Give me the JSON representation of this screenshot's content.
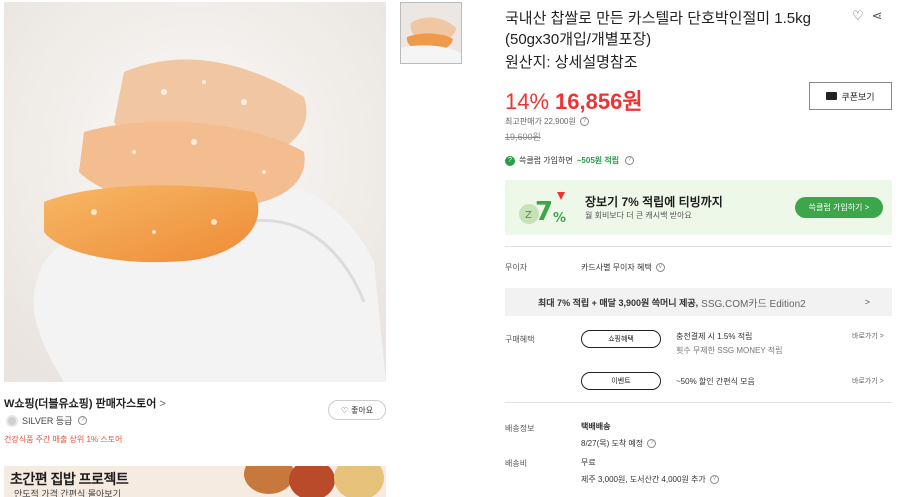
{
  "product": {
    "title": "국내산 찹쌀로 만든 카스텔라 단호박인절미 1.5kg (50gx30개입/개별포장)",
    "origin": "원산지: 상세설명참조",
    "discount": "14%",
    "price": "16,856원",
    "max_benefit": "최고판매가 22,900원",
    "original_price": "19,600원"
  },
  "actions": {
    "coupon_label": "쿠폰보기",
    "like_label": "좋아요",
    "wish_icon": "heart-icon",
    "share_icon": "share-icon"
  },
  "seller": {
    "name": "W쇼핑(더블유쇼핑) 판매자스토어",
    "grade": "SILVER 등급",
    "note": "건강식품 주간 매출 상위 1% 스토어"
  },
  "banner": {
    "title": "초간편 집밥 프로젝트",
    "subtitle": "안도적 가격 간편식 몰아보기"
  },
  "ssg": {
    "join_prefix": "쓱클럽 가입하면",
    "join_suffix": "~505원 적립",
    "box_title": "장보기 7% 적립에 티빙까지",
    "box_sub": "월 회비보다 더 큰 캐시백 받아요",
    "box_button": "쓱클럽 가입하기 >"
  },
  "benefits": {
    "interest_label": "무이자",
    "interest_value": "카드사별 무이자 혜택",
    "card_bar_main": "최대 7% 적립 + 매달 3,900원 쓱머니 제공,",
    "card_bar_edition": "SSG.COM카드 Edition2",
    "purchase_label": "구매혜택",
    "pill1": "쇼핑혜택",
    "pill1_line1": "충전결제 시 1.5% 적립",
    "pill1_line2": "횟수 무제한 SSG MONEY 적립",
    "pill2": "이벤트",
    "pill2_line1": "~50% 할인 간편식 모음",
    "go_link": "바로가기 >"
  },
  "delivery": {
    "info_label": "배송정보",
    "method": "택배배송",
    "eta": "8/27(목) 도착 예정",
    "fee_label": "배송비",
    "fee": "무료",
    "extra": "제주 3,000원, 도서산간 4,000원 추가"
  },
  "colors": {
    "accent_red": "#e33333",
    "ssg_green": "#3da54a"
  }
}
